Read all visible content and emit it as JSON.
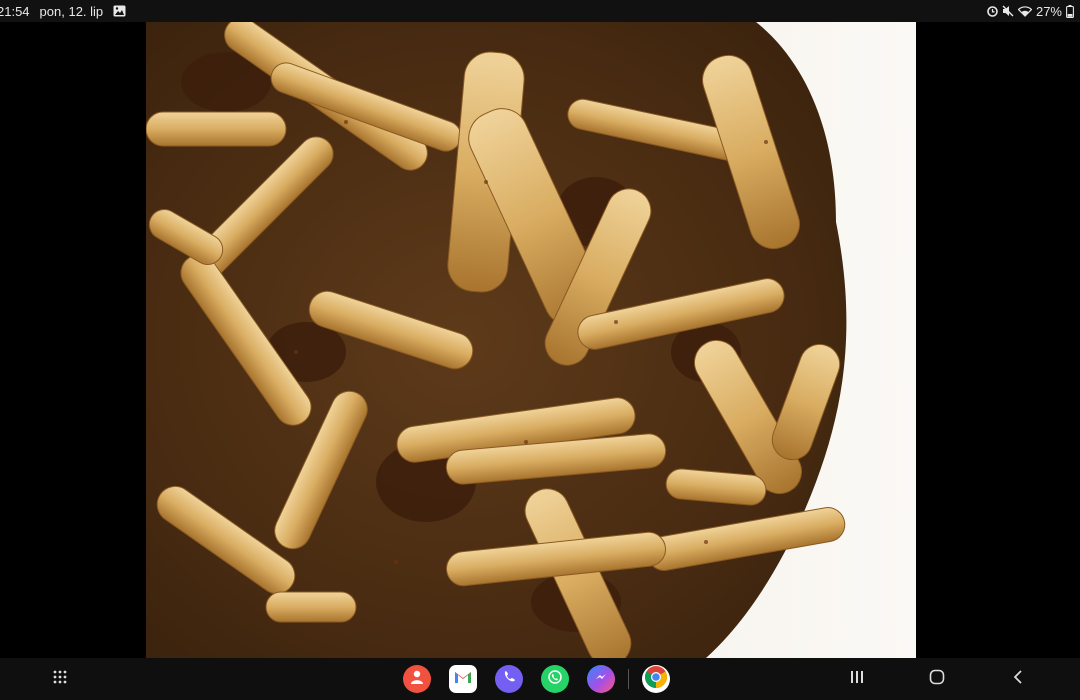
{
  "status_bar": {
    "time": "21:54",
    "date": "pon, 12. lip",
    "battery": "27%",
    "icons": [
      "gallery-icon",
      "alarm-icon",
      "mute-icon",
      "wifi-icon",
      "battery-icon"
    ]
  },
  "viewer": {
    "image_subject": "pasta-with-meat-sauce-photo"
  },
  "taskbar": {
    "apps": [
      {
        "name": "Contacts",
        "icon": "contacts-icon",
        "color": "#f0523f"
      },
      {
        "name": "Gmail",
        "icon": "gmail-icon",
        "color": "#ffffff"
      },
      {
        "name": "Viber",
        "icon": "viber-icon",
        "color": "#7360f2"
      },
      {
        "name": "WhatsApp",
        "icon": "whatsapp-icon",
        "color": "#25d366"
      },
      {
        "name": "Messenger",
        "icon": "messenger-icon",
        "color": "#a64ee6"
      },
      {
        "name": "Chrome",
        "icon": "chrome-icon",
        "color": "#ffffff"
      }
    ],
    "nav": [
      "app-drawer-icon",
      "recents-icon",
      "home-icon",
      "back-icon"
    ]
  }
}
